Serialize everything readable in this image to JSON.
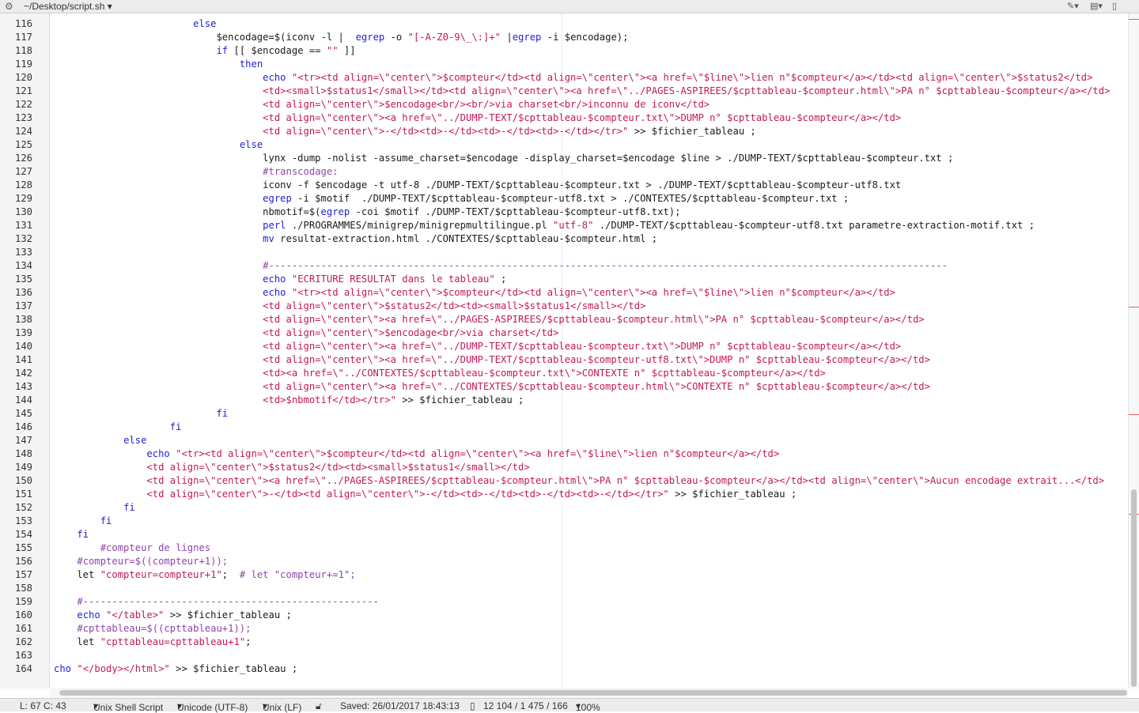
{
  "titlebar": {
    "path": "~/Desktop/script.sh",
    "icons": [
      "gear-icon",
      "pen-icon",
      "stack-icon",
      "document-icon"
    ]
  },
  "editor": {
    "lines": [
      {
        "n": "116",
        "tokens": [
          [
            "ws",
            "                        "
          ],
          [
            "kw",
            "else"
          ]
        ]
      },
      {
        "n": "117",
        "tokens": [
          [
            "ws",
            "                            $encodage=$(iconv -l |  "
          ],
          [
            "kw",
            "egrep"
          ],
          [
            "ws",
            " -o "
          ],
          [
            "str",
            "\"[-A-Z0-9\\_\\:]+\""
          ],
          [
            "ws",
            " |"
          ],
          [
            "kw",
            "egrep"
          ],
          [
            "ws",
            " -i $encodage);"
          ]
        ]
      },
      {
        "n": "118",
        "tokens": [
          [
            "ws",
            "                            "
          ],
          [
            "kw",
            "if"
          ],
          [
            "ws",
            " [[ $encodage == "
          ],
          [
            "str",
            "\"\""
          ],
          [
            "ws",
            " ]]"
          ]
        ]
      },
      {
        "n": "119",
        "tokens": [
          [
            "ws",
            "                                "
          ],
          [
            "kw",
            "then"
          ]
        ]
      },
      {
        "n": "120",
        "tokens": [
          [
            "ws",
            "                                    "
          ],
          [
            "kw",
            "echo"
          ],
          [
            "ws",
            " "
          ],
          [
            "str",
            "\"<tr><td align=\\\"center\\\">$compteur</td><td align=\\\"center\\\"><a href=\\\"$line\\\">lien n°$compteur</a></td><td align=\\\"center\\\">$status2</td>"
          ]
        ]
      },
      {
        "n": "121",
        "tokens": [
          [
            "str",
            "                                    <td><small>$status1</small></td><td align=\\\"center\\\"><a href=\\\"../PAGES-ASPIREES/$cpttableau-$compteur.html\\\">PA n° $cpttableau-$compteur</a></td>"
          ]
        ]
      },
      {
        "n": "122",
        "tokens": [
          [
            "str",
            "                                    <td align=\\\"center\\\">$encodage<br/><br/>via charset<br/>inconnu de iconv</td>"
          ]
        ]
      },
      {
        "n": "123",
        "tokens": [
          [
            "str",
            "                                    <td align=\\\"center\\\"><a href=\\\"../DUMP-TEXT/$cpttableau-$compteur.txt\\\">DUMP n° $cpttableau-$compteur</a></td>"
          ]
        ]
      },
      {
        "n": "124",
        "tokens": [
          [
            "str",
            "                                    <td align=\\\"center\\\">-</td><td>-</td><td>-</td><td>-</td></tr>\""
          ],
          [
            "ws",
            " >> $fichier_tableau ;"
          ]
        ]
      },
      {
        "n": "125",
        "tokens": [
          [
            "ws",
            "                                "
          ],
          [
            "kw",
            "else"
          ]
        ]
      },
      {
        "n": "126",
        "tokens": [
          [
            "ws",
            "                                    lynx -dump -nolist -assume_charset=$encodage -display_charset=$encodage $line > ./DUMP-TEXT/$cpttableau-$compteur.txt ;"
          ]
        ]
      },
      {
        "n": "127",
        "tokens": [
          [
            "ws",
            "                                    "
          ],
          [
            "cm",
            "#transcodage:"
          ]
        ]
      },
      {
        "n": "128",
        "tokens": [
          [
            "ws",
            "                                    iconv -f $encodage -t utf-8 ./DUMP-TEXT/$cpttableau-$compteur.txt > ./DUMP-TEXT/$cpttableau-$compteur-utf8.txt"
          ]
        ]
      },
      {
        "n": "129",
        "tokens": [
          [
            "ws",
            "                                    "
          ],
          [
            "kw",
            "egrep"
          ],
          [
            "ws",
            " -i $motif  ./DUMP-TEXT/$cpttableau-$compteur-utf8.txt > ./CONTEXTES/$cpttableau-$compteur.txt ;"
          ]
        ]
      },
      {
        "n": "130",
        "tokens": [
          [
            "ws",
            "                                    nbmotif=$("
          ],
          [
            "kw",
            "egrep"
          ],
          [
            "ws",
            " -coi $motif ./DUMP-TEXT/$cpttableau-$compteur-utf8.txt);"
          ]
        ]
      },
      {
        "n": "131",
        "tokens": [
          [
            "ws",
            "                                    "
          ],
          [
            "kw",
            "perl"
          ],
          [
            "ws",
            " ./PROGRAMMES/minigrep/minigrepmultilingue.pl "
          ],
          [
            "str",
            "\"utf-8\""
          ],
          [
            "ws",
            " ./DUMP-TEXT/$cpttableau-$compteur-utf8.txt parametre-extraction-motif.txt ;"
          ]
        ]
      },
      {
        "n": "132",
        "tokens": [
          [
            "ws",
            "                                    "
          ],
          [
            "kw",
            "mv"
          ],
          [
            "ws",
            " resultat-extraction.html ./CONTEXTES/$cpttableau-$compteur.html ;"
          ]
        ]
      },
      {
        "n": "133",
        "tokens": []
      },
      {
        "n": "134",
        "tokens": [
          [
            "ws",
            "                                    "
          ],
          [
            "cm",
            "#---------------------------------------------------------------------------------------------------------------------"
          ]
        ]
      },
      {
        "n": "135",
        "tokens": [
          [
            "ws",
            "                                    "
          ],
          [
            "kw",
            "echo"
          ],
          [
            "ws",
            " "
          ],
          [
            "str",
            "\"ECRITURE RESULTAT dans le tableau\""
          ],
          [
            "ws",
            " ;"
          ]
        ]
      },
      {
        "n": "136",
        "tokens": [
          [
            "ws",
            "                                    "
          ],
          [
            "kw",
            "echo"
          ],
          [
            "ws",
            " "
          ],
          [
            "str",
            "\"<tr><td align=\\\"center\\\">$compteur</td><td align=\\\"center\\\"><a href=\\\"$line\\\">lien n°$compteur</a></td>"
          ]
        ]
      },
      {
        "n": "137",
        "tokens": [
          [
            "str",
            "                                    <td align=\\\"center\\\">$status2</td><td><small>$status1</small></td>"
          ]
        ]
      },
      {
        "n": "138",
        "tokens": [
          [
            "str",
            "                                    <td align=\\\"center\\\"><a href=\\\"../PAGES-ASPIREES/$cpttableau-$compteur.html\\\">PA n° $cpttableau-$compteur</a></td>"
          ]
        ]
      },
      {
        "n": "139",
        "tokens": [
          [
            "str",
            "                                    <td align=\\\"center\\\">$encodage<br/>via charset</td>"
          ]
        ]
      },
      {
        "n": "140",
        "tokens": [
          [
            "str",
            "                                    <td align=\\\"center\\\"><a href=\\\"../DUMP-TEXT/$cpttableau-$compteur.txt\\\">DUMP n° $cpttableau-$compteur</a></td>"
          ]
        ]
      },
      {
        "n": "141",
        "tokens": [
          [
            "str",
            "                                    <td align=\\\"center\\\"><a href=\\\"../DUMP-TEXT/$cpttableau-$compteur-utf8.txt\\\">DUMP n° $cpttableau-$compteur</a></td>"
          ]
        ]
      },
      {
        "n": "142",
        "tokens": [
          [
            "str",
            "                                    <td><a href=\\\"../CONTEXTES/$cpttableau-$compteur.txt\\\">CONTEXTE n° $cpttableau-$compteur</a></td>"
          ]
        ]
      },
      {
        "n": "143",
        "tokens": [
          [
            "str",
            "                                    <td align=\\\"center\\\"><a href=\\\"../CONTEXTES/$cpttableau-$compteur.html\\\">CONTEXTE n° $cpttableau-$compteur</a></td>"
          ]
        ]
      },
      {
        "n": "144",
        "tokens": [
          [
            "str",
            "                                    <td>$nbmotif</td></tr>\""
          ],
          [
            "ws",
            " >> $fichier_tableau ;"
          ]
        ]
      },
      {
        "n": "145",
        "tokens": [
          [
            "ws",
            "                            "
          ],
          [
            "kw",
            "fi"
          ]
        ]
      },
      {
        "n": "146",
        "tokens": [
          [
            "ws",
            "                    "
          ],
          [
            "kw",
            "fi"
          ]
        ]
      },
      {
        "n": "147",
        "tokens": [
          [
            "ws",
            "            "
          ],
          [
            "kw",
            "else"
          ]
        ]
      },
      {
        "n": "148",
        "tokens": [
          [
            "ws",
            "                "
          ],
          [
            "kw",
            "echo"
          ],
          [
            "ws",
            " "
          ],
          [
            "str",
            "\"<tr><td align=\\\"center\\\">$compteur</td><td align=\\\"center\\\"><a href=\\\"$line\\\">lien n°$compteur</a></td>"
          ]
        ]
      },
      {
        "n": "149",
        "tokens": [
          [
            "str",
            "                <td align=\\\"center\\\">$status2</td><td><small>$status1</small></td>"
          ]
        ]
      },
      {
        "n": "150",
        "tokens": [
          [
            "str",
            "                <td align=\\\"center\\\"><a href=\\\"../PAGES-ASPIREES/$cpttableau-$compteur.html\\\">PA n° $cpttableau-$compteur</a></td><td align=\\\"center\\\">Aucun encodage extrait...</td>"
          ]
        ]
      },
      {
        "n": "151",
        "tokens": [
          [
            "str",
            "                <td align=\\\"center\\\">-</td><td align=\\\"center\\\">-</td><td>-</td><td>-</td><td>-</td></tr>\""
          ],
          [
            "ws",
            " >> $fichier_tableau ;"
          ]
        ]
      },
      {
        "n": "152",
        "tokens": [
          [
            "ws",
            "            "
          ],
          [
            "kw",
            "fi"
          ]
        ]
      },
      {
        "n": "153",
        "tokens": [
          [
            "ws",
            "        "
          ],
          [
            "kw",
            "fi"
          ]
        ]
      },
      {
        "n": "154",
        "tokens": [
          [
            "ws",
            "    "
          ],
          [
            "kw",
            "fi"
          ]
        ]
      },
      {
        "n": "155",
        "tokens": [
          [
            "ws",
            "        "
          ],
          [
            "cm",
            "#compteur de lignes"
          ]
        ]
      },
      {
        "n": "156",
        "tokens": [
          [
            "ws",
            "    "
          ],
          [
            "cm",
            "#compteur=$((compteur+1));"
          ]
        ]
      },
      {
        "n": "157",
        "tokens": [
          [
            "ws",
            "    let "
          ],
          [
            "str",
            "\"compteur=compteur+1\""
          ],
          [
            "ws",
            ";  "
          ],
          [
            "cm",
            "# let \"compteur+=1\";"
          ]
        ]
      },
      {
        "n": "158",
        "tokens": []
      },
      {
        "n": "159",
        "tokens": [
          [
            "ws",
            "    "
          ],
          [
            "cm",
            "#---------------------------------------------------"
          ]
        ]
      },
      {
        "n": "160",
        "tokens": [
          [
            "ws",
            "    "
          ],
          [
            "kw",
            "echo"
          ],
          [
            "ws",
            " "
          ],
          [
            "str",
            "\"</table>\""
          ],
          [
            "ws",
            " >> $fichier_tableau ;"
          ]
        ]
      },
      {
        "n": "161",
        "tokens": [
          [
            "ws",
            "    "
          ],
          [
            "cm",
            "#cpttableau=$((cpttableau+1));"
          ]
        ]
      },
      {
        "n": "162",
        "tokens": [
          [
            "ws",
            "    let "
          ],
          [
            "str",
            "\"cpttableau=cpttableau+1\""
          ],
          [
            "ws",
            ";"
          ]
        ]
      },
      {
        "n": "163",
        "tokens": []
      },
      {
        "n": "164",
        "tokens": [
          [
            "kw",
            "cho"
          ],
          [
            "ws",
            " "
          ],
          [
            "str",
            "\"</body></html>\""
          ],
          [
            "ws",
            " >> $fichier_tableau ;"
          ]
        ]
      }
    ]
  },
  "statusbar": {
    "position": "L: 67 C: 43",
    "syntax": "Unix Shell Script",
    "encoding": "Unicode (UTF-8)",
    "line_endings": "Unix (LF)",
    "saved": "Saved: 26/01/2017 18:43:13",
    "stats": "12 104 / 1 475 / 166",
    "zoom": "100%"
  },
  "colors": {
    "keyword": "#1f1fcf",
    "string": "#c2185b",
    "comment": "#8e44ad"
  }
}
